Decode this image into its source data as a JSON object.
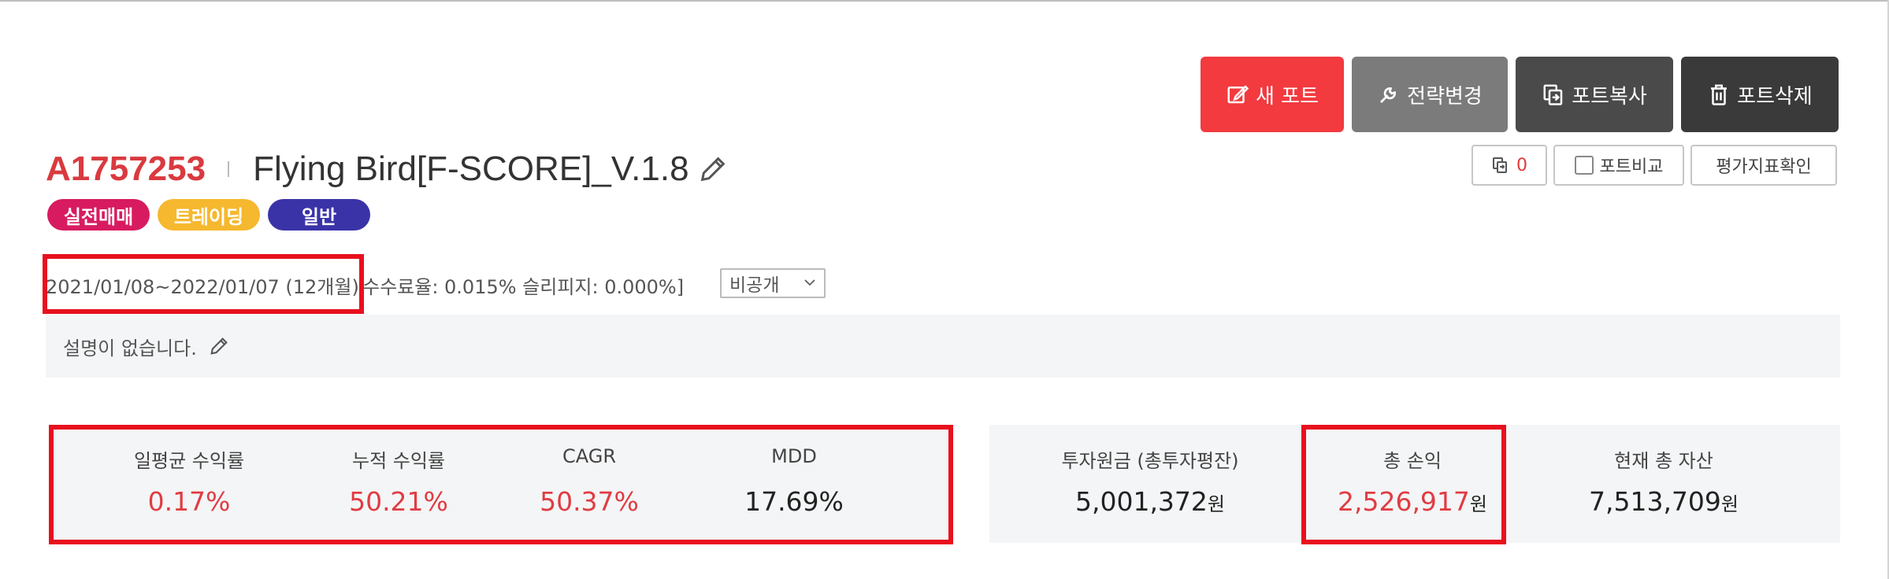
{
  "actions": {
    "new_label": "새 포트",
    "strategy_label": "전략변경",
    "copy_label": "포트복사",
    "delete_label": "포트삭제"
  },
  "small_actions": {
    "count": "0",
    "compare_label": "포트비교",
    "eval_label": "평가지표확인"
  },
  "portfolio": {
    "id": "A1757253",
    "name": "Flying Bird[F-SCORE]_V.1.8",
    "badges": [
      "실전매매",
      "트레이딩",
      "일반"
    ]
  },
  "info": {
    "period": "2021/01/08~2022/01/07 (12개월)",
    "fees": "수수료율: 0.015% 슬리피지: 0.000%]",
    "visibility": "비공개"
  },
  "description": "설명이 없습니다.",
  "stats_left": [
    {
      "label": "일평균 수익률",
      "value": "0.17%"
    },
    {
      "label": "누적 수익률",
      "value": "50.21%"
    },
    {
      "label": "CAGR",
      "value": "50.37%"
    },
    {
      "label": "MDD",
      "value": "17.69%"
    }
  ],
  "stats_right": [
    {
      "label": "투자원금 (총투자평잔)",
      "value": "5,001,372",
      "unit": "원"
    },
    {
      "label": "총 손익",
      "value": "2,526,917",
      "unit": "원"
    },
    {
      "label": "현재 총 자산",
      "value": "7,513,709",
      "unit": "원"
    }
  ],
  "colors": {
    "brand_red": "#f23a3f",
    "profit_red": "#e03c43",
    "highlight": "#e8101e",
    "badge_live": "#d81b60",
    "badge_trading": "#f5b82e",
    "badge_general": "#3a33a8"
  }
}
